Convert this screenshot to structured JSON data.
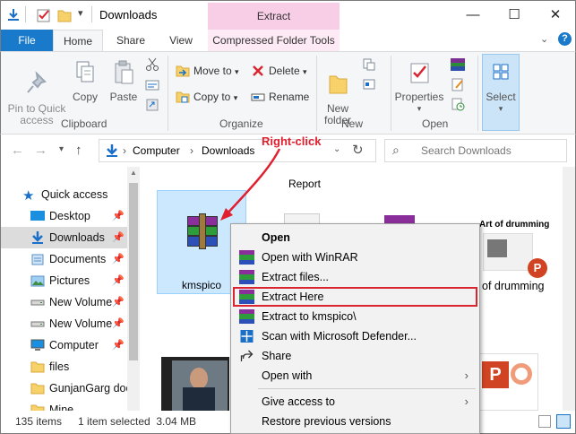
{
  "window": {
    "title": "Downloads",
    "contextual_tab_header": "Extract",
    "controls": {
      "minimize": "—",
      "maximize": "☐",
      "close": "✕"
    }
  },
  "tabs": {
    "file": "File",
    "home": "Home",
    "share": "Share",
    "view": "View",
    "compressed": "Compressed Folder Tools"
  },
  "ribbon": {
    "clipboard": {
      "pin": "Pin to Quick\naccess",
      "copy": "Copy",
      "paste": "Paste",
      "label": "Clipboard"
    },
    "organize": {
      "move_to": "Move to",
      "copy_to": "Copy to",
      "delete": "Delete",
      "rename": "Rename",
      "label": "Organize"
    },
    "new": {
      "new_folder": "New\nfolder",
      "label": "New"
    },
    "open": {
      "properties": "Properties",
      "label": "Open"
    },
    "select": {
      "select": "Select"
    }
  },
  "addressbar": {
    "crumbs": [
      "Computer",
      "Downloads"
    ],
    "search_placeholder": "Search Downloads",
    "refresh_icon": "refresh-icon"
  },
  "annotation": {
    "text": "Right-click",
    "color": "#e0202f"
  },
  "navpane": {
    "items": [
      {
        "label": "Quick access",
        "icon": "star-icon",
        "pinned": false
      },
      {
        "label": "Desktop",
        "icon": "desktop-icon",
        "pinned": true
      },
      {
        "label": "Downloads",
        "icon": "download-icon",
        "pinned": true
      },
      {
        "label": "Documents",
        "icon": "documents-icon",
        "pinned": true
      },
      {
        "label": "Pictures",
        "icon": "pictures-icon",
        "pinned": true
      },
      {
        "label": "New Volume",
        "icon": "drive-icon",
        "pinned": true
      },
      {
        "label": "New Volume",
        "icon": "drive-icon",
        "pinned": true
      },
      {
        "label": "Computer",
        "icon": "computer-icon",
        "pinned": true
      },
      {
        "label": "files",
        "icon": "folder-icon",
        "pinned": false
      },
      {
        "label": "GunjanGarg doc",
        "icon": "folder-icon",
        "pinned": false
      },
      {
        "label": "Mine",
        "icon": "folder-icon",
        "pinned": false
      }
    ]
  },
  "files": {
    "top_label_partial": "Report",
    "selected_file": "kmspico",
    "drumming_file": "of drumming",
    "drumming_thumb_title": "Art of drumming"
  },
  "statusbar": {
    "count": "135 items",
    "selection": "1 item selected  3.04 MB"
  },
  "context_menu": {
    "items": [
      {
        "label": "Open",
        "bold": true,
        "icon": ""
      },
      {
        "label": "Open with WinRAR",
        "icon": "winrar-icon"
      },
      {
        "label": "Extract files...",
        "icon": "winrar-icon"
      },
      {
        "label": "Extract Here",
        "icon": "winrar-icon",
        "highlighted": true
      },
      {
        "label": "Extract to kmspico\\",
        "icon": "winrar-icon"
      },
      {
        "label": "Scan with Microsoft Defender...",
        "icon": "defender-icon"
      },
      {
        "label": "Share",
        "icon": "share-icon"
      },
      {
        "label": "Open with",
        "icon": "",
        "submenu": true
      },
      {
        "label": "Give access to",
        "icon": "",
        "submenu": true
      },
      {
        "label": "Restore previous versions",
        "icon": ""
      }
    ]
  },
  "colors": {
    "accent": "#1979ca",
    "highlight_border": "#d9252f",
    "contextual": "#f8cde6"
  }
}
